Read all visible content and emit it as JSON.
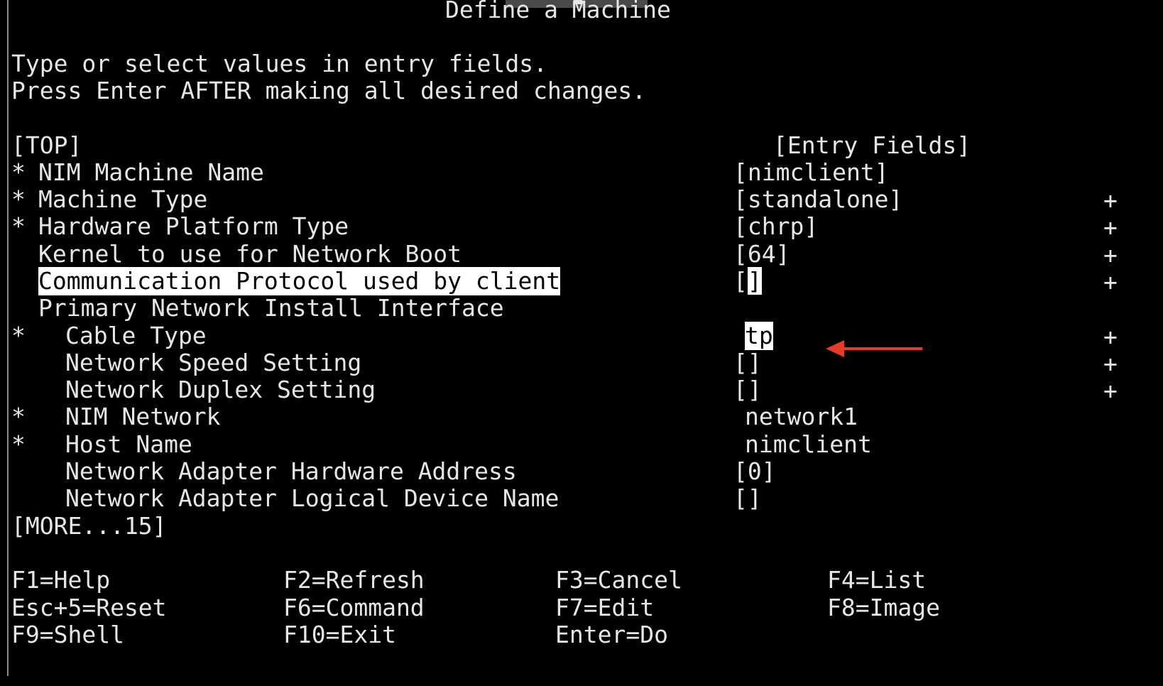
{
  "screen": {
    "title": "Define a Machine",
    "instructions": [
      "Type or select values in entry fields.",
      "Press Enter AFTER making all desired changes."
    ],
    "top_marker": "[TOP]",
    "entry_fields_header": "[Entry Fields]",
    "more_marker": "[MORE...15]"
  },
  "fields": [
    {
      "required": "*",
      "label": "NIM Machine Name",
      "value": "[nimclient]",
      "list": ""
    },
    {
      "required": "*",
      "label": "Machine Type",
      "value": "[standalone]",
      "list": "+"
    },
    {
      "required": "*",
      "label": "Hardware Platform Type",
      "value": "[chrp]",
      "list": "+"
    },
    {
      "required": "",
      "label": "Kernel to use for Network Boot",
      "value": "[64]",
      "list": "+"
    },
    {
      "required": "",
      "label": "Communication Protocol used by client",
      "value_open": "[",
      "value_close": "]",
      "list": "+"
    },
    {
      "required": "",
      "label": "Primary Network Install Interface",
      "value": "",
      "list": ""
    },
    {
      "required": "*",
      "label": "Cable Type",
      "value": "tp",
      "list": "+"
    },
    {
      "required": "",
      "label": "Network Speed Setting",
      "value": "[]",
      "list": "+"
    },
    {
      "required": "",
      "label": "Network Duplex Setting",
      "value": "[]",
      "list": "+"
    },
    {
      "required": "*",
      "label": "NIM Network",
      "value": "network1",
      "list": ""
    },
    {
      "required": "*",
      "label": "Host Name",
      "value": "nimclient",
      "list": ""
    },
    {
      "required": "",
      "label": "Network Adapter Hardware Address",
      "value": "[0]",
      "list": ""
    },
    {
      "required": "",
      "label": "Network Adapter Logical Device Name",
      "value": "[]",
      "list": ""
    }
  ],
  "function_keys": [
    [
      "F1=Help",
      "F2=Refresh",
      "F3=Cancel",
      "F4=List"
    ],
    [
      "Esc+5=Reset",
      "F6=Command",
      "F7=Edit",
      "F8=Image"
    ],
    [
      "F9=Shell",
      "F10=Exit",
      "Enter=Do",
      ""
    ]
  ],
  "annotation": {
    "arrow_color": "#e53b2c",
    "arrow_icon": "arrow-left-icon"
  },
  "colors": {
    "background": "#000000",
    "text": "#e6e6e6",
    "highlight_bg": "#ffffff",
    "highlight_fg": "#000000"
  }
}
